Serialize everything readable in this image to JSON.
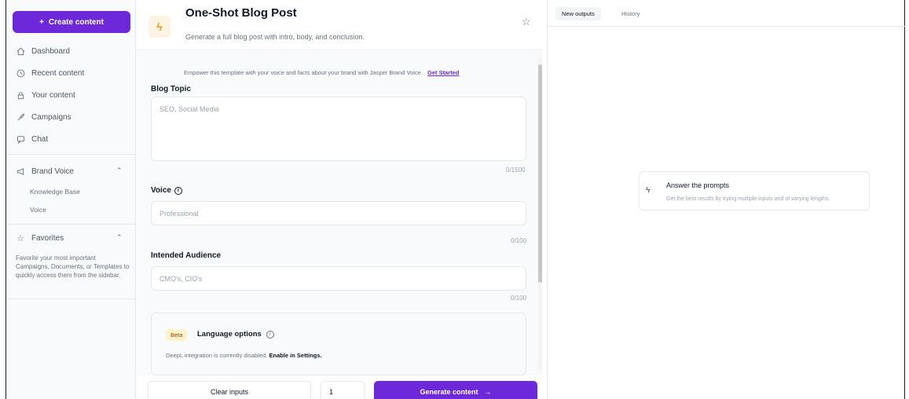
{
  "sidebar": {
    "create_label": "Create content",
    "items": [
      {
        "label": "Dashboard",
        "icon": "home-icon"
      },
      {
        "label": "Recent content",
        "icon": "clock-icon"
      },
      {
        "label": "Your content",
        "icon": "lock-icon"
      },
      {
        "label": "Campaigns",
        "icon": "rocket-icon"
      },
      {
        "label": "Chat",
        "icon": "chat-icon"
      }
    ],
    "brand_voice": {
      "label": "Brand Voice",
      "sub_items": [
        "Knowledge Base",
        "Voice"
      ]
    },
    "favorites": {
      "label": "Favorites",
      "description": "Favorite your most important Campaigns, Documents, or Templates to quickly access them from the sidebar."
    }
  },
  "header": {
    "title": "One-Shot Blog Post",
    "subtitle": "Generate a full blog post with intro, body, and conclusion."
  },
  "brand_note": {
    "text": "Empower this template with your voice and facts about your brand with Jasper Brand Voice.",
    "link": "Get Started"
  },
  "form": {
    "blog_topic": {
      "label": "Blog Topic",
      "placeholder": "SEO, Social Media",
      "counter": "0/1500"
    },
    "voice": {
      "label": "Voice",
      "placeholder": "Professional",
      "counter": "0/100"
    },
    "audience": {
      "label": "Intended Audience",
      "placeholder": "CMO's, CIO's",
      "counter": "0/100"
    },
    "language": {
      "badge": "Beta",
      "title": "Language options",
      "note": "DeepL integration is currently disabled.",
      "note_link": "Enable in Settings."
    }
  },
  "footer": {
    "clear_label": "Clear inputs",
    "quantity": "1",
    "generate_label": "Generate content"
  },
  "right_panel": {
    "tabs": [
      "New outputs",
      "History"
    ],
    "active_tab": "New outputs",
    "prompt_card": {
      "title": "Answer the prompts",
      "subtitle": "Get the best results by trying multiple inputs and of varying lengths."
    }
  },
  "colors": {
    "accent": "#6d28d9",
    "warning": "#f59e0b"
  }
}
